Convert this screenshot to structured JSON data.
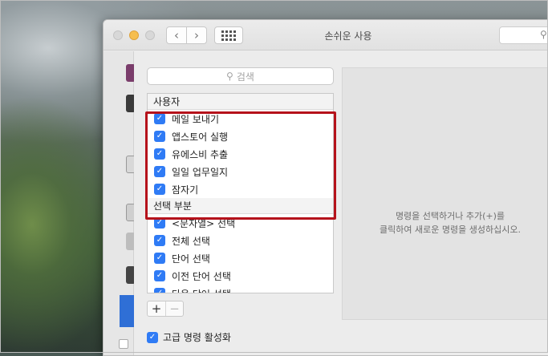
{
  "window": {
    "title": "손쉬운 사용",
    "back_glyph": "‹",
    "forward_glyph": "›",
    "toolbar_search_icon": "search-icon"
  },
  "search": {
    "placeholder": "검색",
    "icon": "search-icon"
  },
  "groups": [
    {
      "title": "사용자",
      "items": [
        {
          "label": "메일 보내기",
          "checked": true
        },
        {
          "label": "앱스토어 실행",
          "checked": true
        },
        {
          "label": "유에스비 추출",
          "checked": true
        },
        {
          "label": "일일 업무일지",
          "checked": true
        },
        {
          "label": "잠자기",
          "checked": true
        }
      ]
    },
    {
      "title": "선택 부분",
      "items": [
        {
          "label": "<문자열> 선택",
          "checked": true
        },
        {
          "label": "전체 선택",
          "checked": true
        },
        {
          "label": "단어 선택",
          "checked": true
        },
        {
          "label": "이전 단어 선택",
          "checked": true
        },
        {
          "label": "다음 단어 선택",
          "checked": true
        }
      ]
    }
  ],
  "list_controls": {
    "add_label": "+",
    "remove_label": "−"
  },
  "detail": {
    "line1": "명령을 선택하거나 추가(+)를",
    "line2": "클릭하여 새로운 명령을 생성하십시오."
  },
  "advanced": {
    "label": "고급 명령 활성화",
    "checked": true
  },
  "colors": {
    "accent": "#2f7bf5",
    "highlight_border": "#b5121b"
  }
}
